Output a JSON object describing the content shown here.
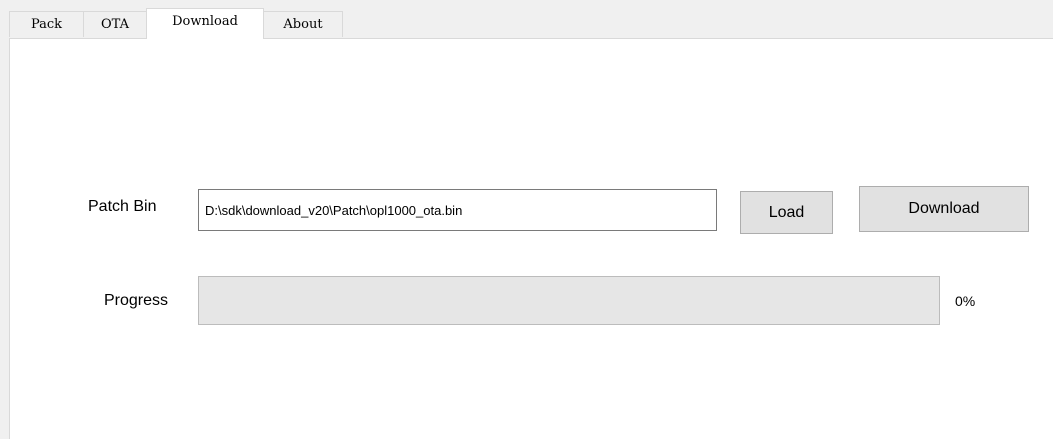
{
  "tabs": [
    {
      "label": "Pack"
    },
    {
      "label": "OTA"
    },
    {
      "label": "Download",
      "active": true
    },
    {
      "label": "About"
    }
  ],
  "download": {
    "patch_label": "Patch Bin",
    "patch_path": "D:\\sdk\\download_v20\\Patch\\opl1000_ota.bin",
    "load_label": "Load",
    "download_label": "Download",
    "progress_label": "Progress",
    "progress_fraction": 0,
    "progress_text": "0%"
  },
  "colors": {
    "panel_bg": "#ffffff",
    "window_bg": "#f0f0f0",
    "button_bg": "#e1e1e1",
    "progress_track": "#e6e6e6",
    "progress_fill": "#06b025"
  }
}
